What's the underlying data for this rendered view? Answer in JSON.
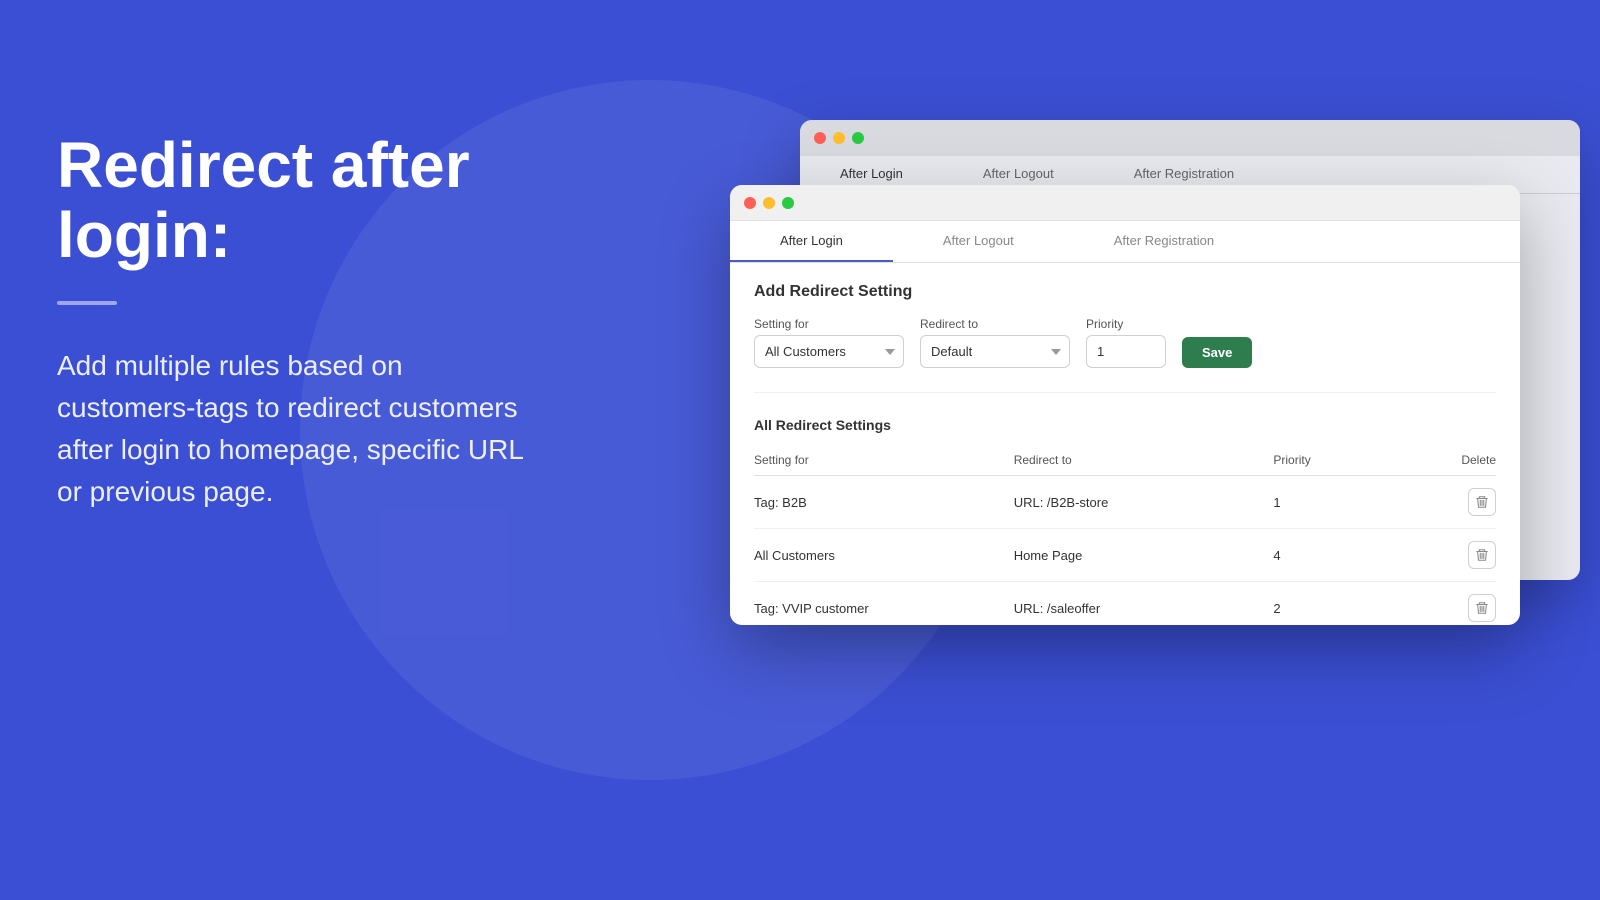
{
  "page": {
    "background_color": "#3B4FD4"
  },
  "left": {
    "heading_line1": "Redirect after",
    "heading_line2": "login:",
    "description": "Add multiple rules based on customers-tags to redirect customers after login to homepage, specific URL or previous page."
  },
  "window_back": {
    "tabs": [
      {
        "label": "After Login",
        "active": true
      },
      {
        "label": "After Logout",
        "active": false
      },
      {
        "label": "After Registration",
        "active": false
      }
    ]
  },
  "window_front": {
    "tabs": [
      {
        "label": "After Login",
        "active": true
      },
      {
        "label": "After Logout",
        "active": false
      },
      {
        "label": "After Registration",
        "active": false
      }
    ],
    "add_section": {
      "title": "Add Redirect Setting",
      "setting_for_label": "Setting for",
      "setting_for_value": "All Customers",
      "redirect_to_label": "Redirect to",
      "redirect_to_value": "Default",
      "priority_label": "Priority",
      "priority_value": "1",
      "save_button": "Save"
    },
    "table_section": {
      "title": "All Redirect Settings",
      "columns": {
        "setting_for": "Setting for",
        "redirect_to": "Redirect to",
        "priority": "Priority",
        "delete": "Delete"
      },
      "rows": [
        {
          "setting_for": "Tag: B2B",
          "redirect_to": "URL: /B2B-store",
          "priority": "1"
        },
        {
          "setting_for": "All Customers",
          "redirect_to": "Home Page",
          "priority": "4"
        },
        {
          "setting_for": "Tag: VVIP customer",
          "redirect_to": "URL: /saleoffer",
          "priority": "2"
        }
      ]
    }
  }
}
